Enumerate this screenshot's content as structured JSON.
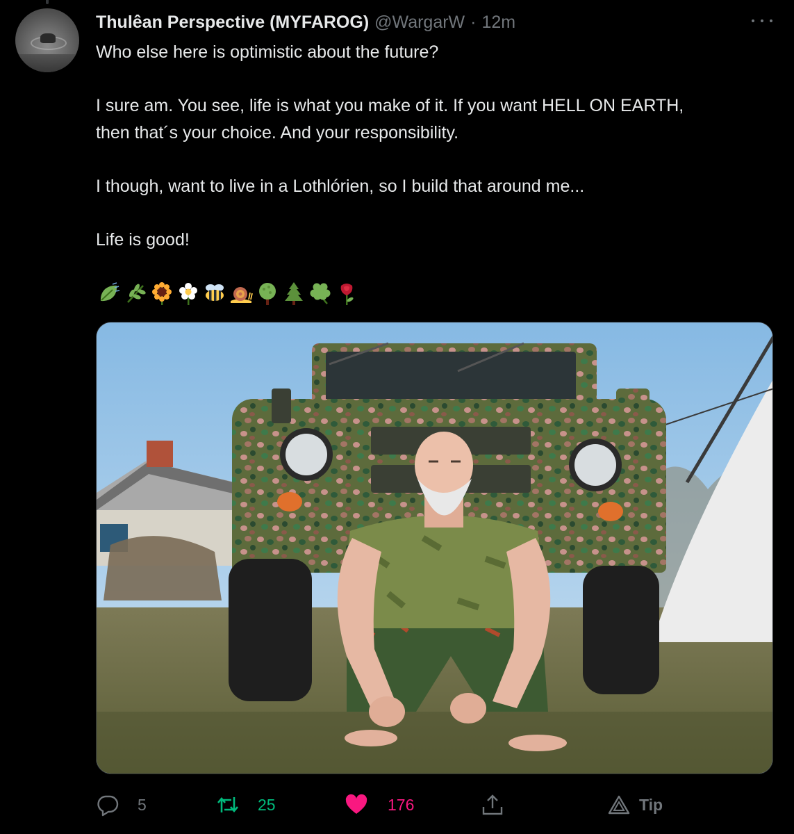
{
  "author": {
    "display_name": "Thulêan Perspective (MYFAROG)",
    "handle": "@WargarW",
    "separator": "·",
    "timestamp": "12m"
  },
  "tweet": {
    "paragraphs": [
      [
        "Who else here is optimistic about the future?"
      ],
      [
        "I sure am. You see, life is what you make of it. If you want HELL ON EARTH,",
        "then that´s your choice. And your responsibility."
      ],
      [
        "I though, want to live in a Lothlórien, so I build that around me..."
      ],
      [
        "Life is good!"
      ]
    ],
    "emojis": [
      "leaf-fluttering-in-wind",
      "herb",
      "sunflower",
      "blossom",
      "honeybee",
      "snail",
      "deciduous-tree",
      "evergreen-tree",
      "shamrock",
      "rose"
    ]
  },
  "actions": {
    "replies": "5",
    "retweets": "25",
    "likes": "176",
    "tip_label": "Tip"
  },
  "colors": {
    "background": "#000000",
    "text_primary": "#e7e9ea",
    "text_secondary": "#71767b",
    "retweet_green": "#00ba7c",
    "like_pink": "#f91880"
  },
  "icons": {
    "more": "more-horizontal-icon",
    "reply": "reply-bubble-icon",
    "retweet": "retweet-arrows-icon",
    "like": "heart-filled-icon",
    "share": "share-upload-icon",
    "tip": "tip-triangle-icon"
  }
}
